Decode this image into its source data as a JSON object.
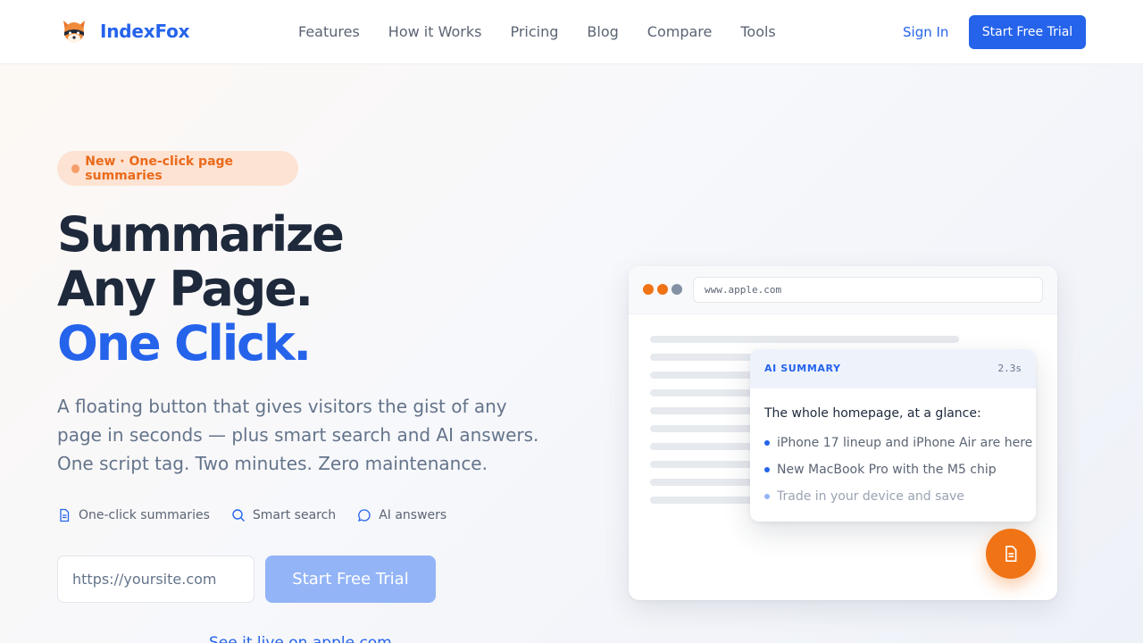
{
  "brand": {
    "name": "IndexFox",
    "logo_icon": "fox-logo-icon"
  },
  "nav": {
    "links": [
      "Features",
      "How it Works",
      "Pricing",
      "Blog",
      "Compare",
      "Tools"
    ],
    "sign_in": "Sign In",
    "cta": "Start Free Trial"
  },
  "hero": {
    "badge": "New · One-click page summaries",
    "headline_line1": "Summarize",
    "headline_line2": "Any Page.",
    "headline_line3": "One Click.",
    "subtext": "A floating button that gives visitors the gist of any page in seconds — plus smart search and AI answers. One script tag. Two minutes. Zero maintenance.",
    "features": [
      {
        "icon": "document-icon",
        "label": "One-click summaries"
      },
      {
        "icon": "search-icon",
        "label": "Smart search"
      },
      {
        "icon": "chat-bubble-icon",
        "label": "AI answers"
      }
    ],
    "url_placeholder": "https://yoursite.com",
    "cta": "Start Free Trial",
    "live_link": "See it live on apple.com"
  },
  "demo": {
    "address": "www.apple.com",
    "window_dot_colors": [
      "#f07315",
      "#f07315",
      "#8391a5"
    ],
    "summary_label": "AI SUMMARY",
    "summary_time": "2.3s",
    "summary_title": "The whole homepage, at a glance:",
    "bullets": [
      "iPhone 17 lineup and iPhone Air are here",
      "New MacBook Pro with the M5 chip",
      "Trade in your device and save"
    ],
    "fab_icon": "document-icon"
  },
  "colors": {
    "accent": "#2563eb",
    "orange": "#f07315",
    "text_dark": "#1e293b",
    "text_muted": "#64748b"
  }
}
